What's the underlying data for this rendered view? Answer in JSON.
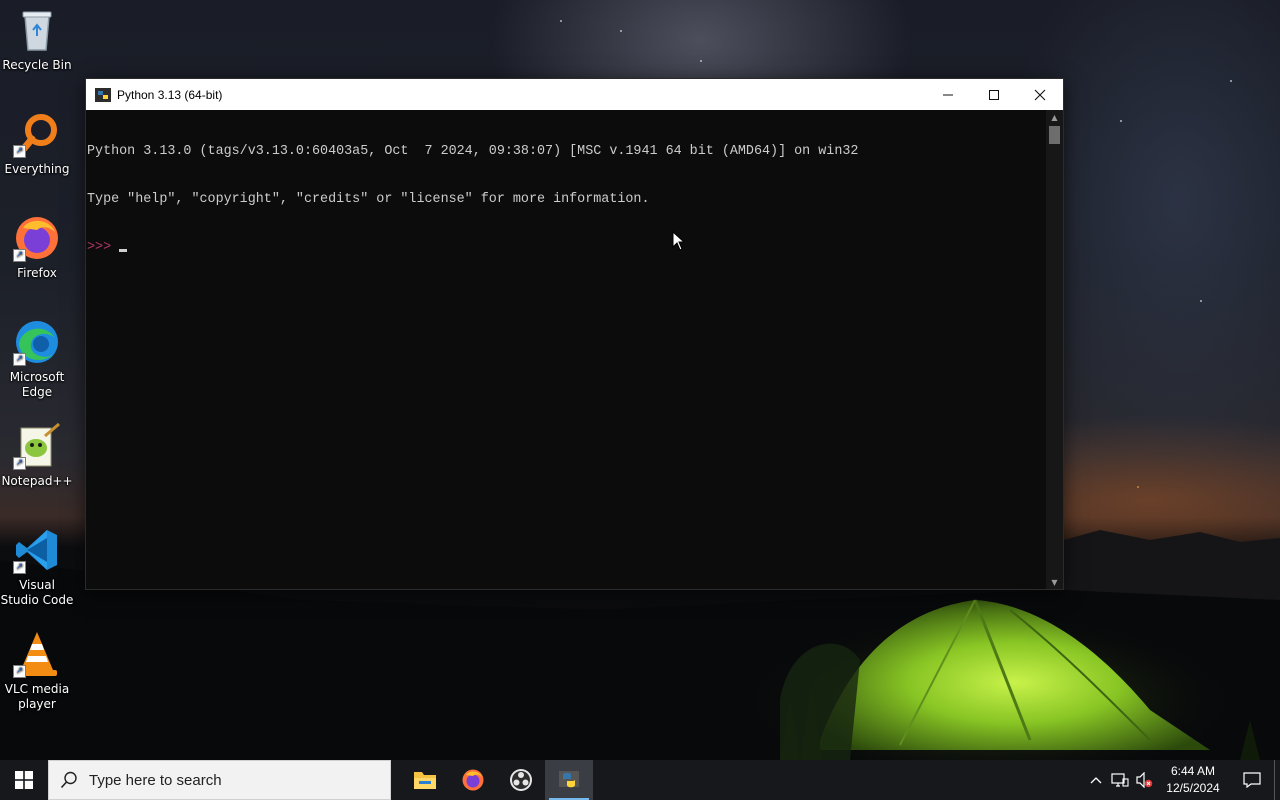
{
  "desktop": {
    "icons": [
      {
        "label": "Recycle Bin",
        "icon": "recycle-bin-icon"
      },
      {
        "label": "Everything",
        "icon": "everything-search-icon"
      },
      {
        "label": "Firefox",
        "icon": "firefox-icon"
      },
      {
        "label": "Microsoft Edge",
        "icon": "edge-icon"
      },
      {
        "label": "Notepad++",
        "icon": "notepad-plus-plus-icon"
      },
      {
        "label": "Visual Studio Code",
        "icon": "vscode-icon"
      },
      {
        "label": "VLC media player",
        "icon": "vlc-icon"
      }
    ]
  },
  "window": {
    "title": "Python 3.13 (64-bit)",
    "controls": {
      "minimize": "—",
      "maximize": "☐",
      "close": "✕"
    },
    "console_lines": [
      "Python 3.13.0 (tags/v3.13.0:60403a5, Oct  7 2024, 09:38:07) [MSC v.1941 64 bit (AMD64)] on win32",
      "Type \"help\", \"copyright\", \"credits\" or \"license\" for more information."
    ],
    "prompt": ">>>"
  },
  "taskbar": {
    "search_placeholder": "Type here to search",
    "apps": [
      {
        "name": "File Explorer",
        "icon": "file-explorer-icon",
        "active": false
      },
      {
        "name": "Firefox",
        "icon": "firefox-icon",
        "active": false
      },
      {
        "name": "OBS",
        "icon": "obs-icon",
        "active": false
      },
      {
        "name": "Python",
        "icon": "python-icon",
        "active": true
      }
    ],
    "tray": {
      "time": "6:44 AM",
      "date": "12/5/2024"
    }
  },
  "colors": {
    "taskbar_bg": "#16181c",
    "console_bg": "#0c0c0c",
    "console_text": "#cccccc",
    "prompt": "#b8346a",
    "active_indicator": "#76b9ed"
  }
}
